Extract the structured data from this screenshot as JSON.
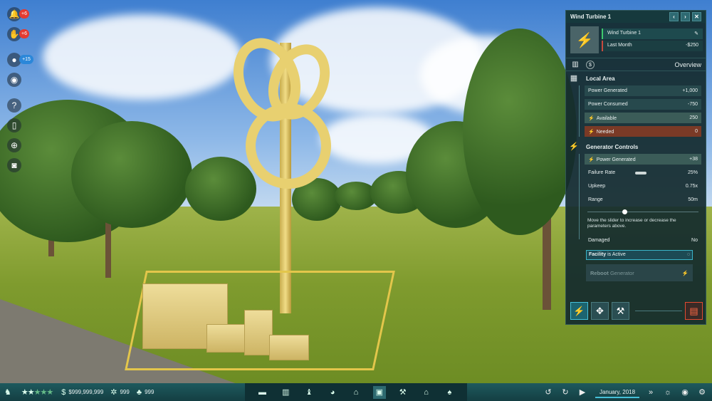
{
  "left_icons": [
    {
      "icon": "bell-icon",
      "symbol": "🔔",
      "badge": "+6"
    },
    {
      "icon": "dinosaur-icon",
      "symbol": "✋",
      "badge": "+6"
    },
    {
      "icon": "egg-icon",
      "symbol": "●",
      "badge": "+15"
    },
    {
      "icon": "eye-icon",
      "symbol": "◉",
      "badge": ""
    },
    {
      "icon": "help-icon",
      "symbol": "?",
      "badge": ""
    },
    {
      "icon": "phone-icon",
      "symbol": "▯",
      "badge": ""
    },
    {
      "icon": "globe-icon",
      "symbol": "⊕",
      "badge": ""
    },
    {
      "icon": "camera-icon",
      "symbol": "◙",
      "badge": ""
    }
  ],
  "panel": {
    "title": "Wind Turbine 1",
    "header_rows": [
      {
        "label": "Wind Turbine 1",
        "value": "✎"
      },
      {
        "label": "Last Month",
        "value": "-$250"
      }
    ],
    "tab_title": "Overview",
    "local_area": {
      "title": "Local Area",
      "rows": [
        {
          "label": "Power Generated",
          "value": "+1,000"
        },
        {
          "label": "Power Consumed",
          "value": "-750"
        },
        {
          "label": "Available",
          "value": "250"
        },
        {
          "label": "Needed",
          "value": "0"
        }
      ]
    },
    "generator_controls": {
      "title": "Generator Controls",
      "power_generated": {
        "label": "Power Generated",
        "value": "+38"
      },
      "failure_rate": {
        "label": "Failure Rate",
        "value": "25%",
        "level": 0.25
      },
      "upkeep": {
        "label": "Upkeep",
        "value": "0.75x"
      },
      "range": {
        "label": "Range",
        "value": "50m",
        "slider_level": 0.35
      },
      "hint": "Move the slider to increase or decrease the parameters above.",
      "damaged": {
        "label": "Damaged",
        "value": "No"
      },
      "status_prefix": "Facility",
      "status_text": "is Active",
      "reboot_label": "Reboot",
      "reboot_label2": "Generator"
    }
  },
  "bottom": {
    "money": "$999,999,999",
    "stat1": "999",
    "stat2": "999",
    "date": "January, 2018"
  }
}
